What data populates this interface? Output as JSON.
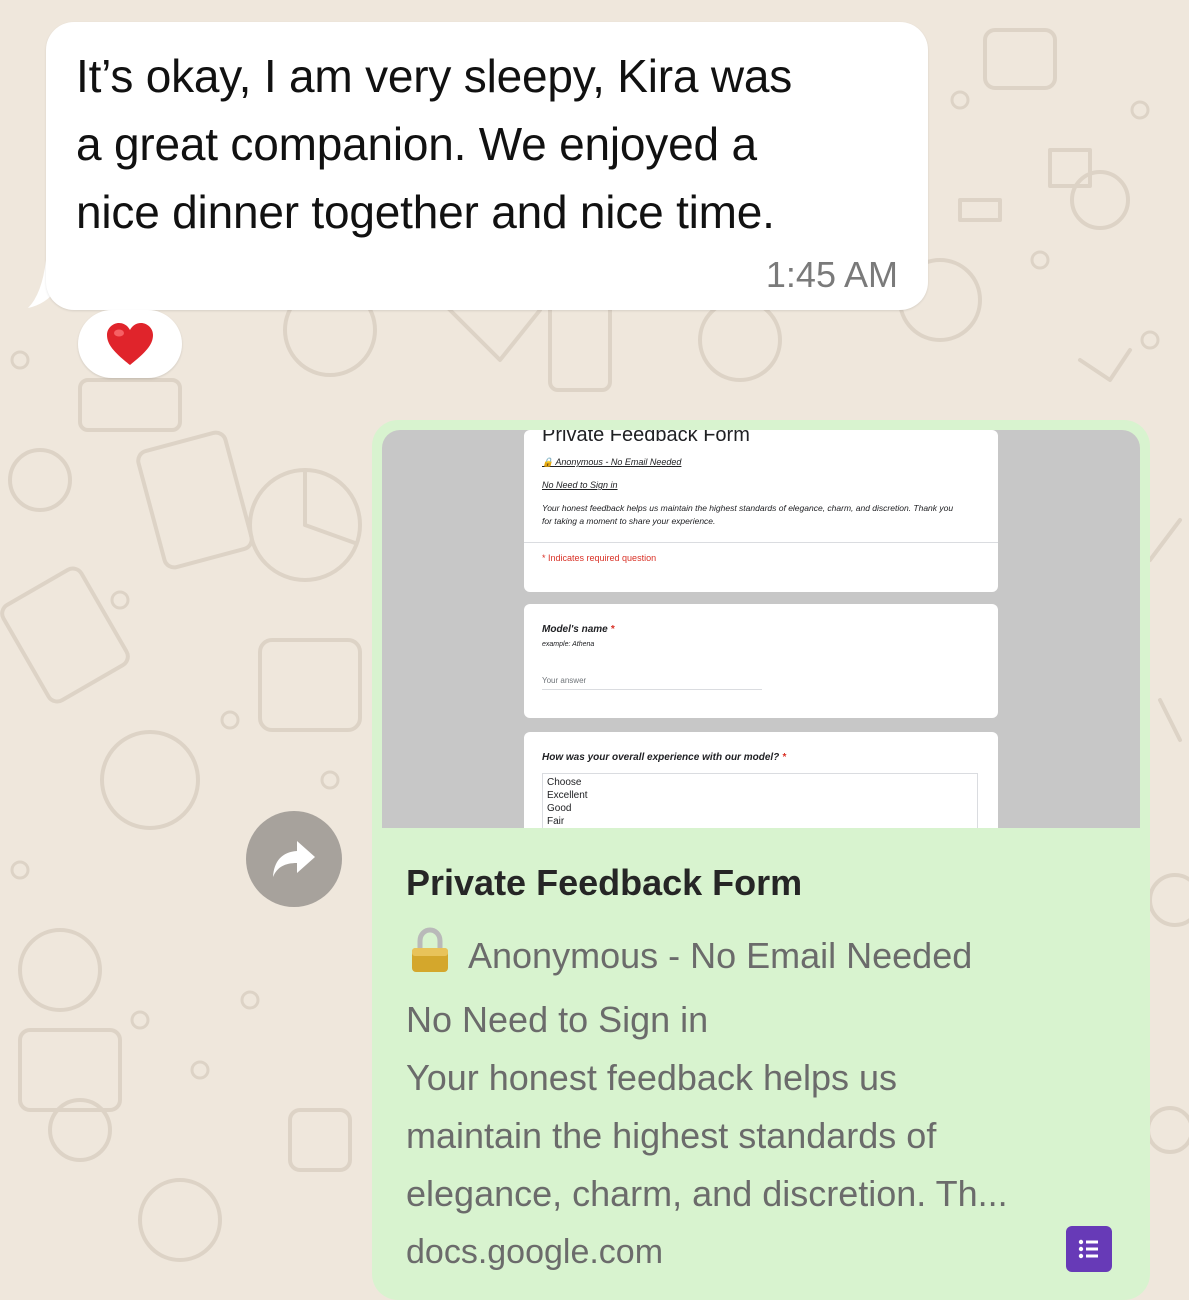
{
  "incoming_message": {
    "lines": [
      "It’s okay, I am very sleepy, Kira was",
      "a great companion. We enjoyed a",
      "nice dinner together and nice time."
    ],
    "time": "1:45 AM",
    "reaction": "❤️"
  },
  "link_preview": {
    "image": {
      "form_title": "Private Feedback Form",
      "line_anonymous": "🔒 Anonymous - No Email Needed",
      "line_sign_in": "No Need to Sign in",
      "description": "Your honest feedback helps us maintain the highest standards of elegance, charm, and discretion. Thank you for taking a moment to share your experience.",
      "required_note": "* Indicates required question",
      "q1_label": "Model's name",
      "q1_example": "example: Athena",
      "q1_placeholder": "Your answer",
      "q2_label": "How was your overall experience with our model?",
      "q2_options": [
        "Choose",
        "Excellent",
        "Good",
        "Fair"
      ]
    },
    "title": "Private Feedback Form",
    "desc_lines": [
      "Anonymous - No Email Needed",
      "No Need to Sign in",
      "Your honest feedback helps us",
      "maintain the highest standards of",
      "elegance, charm, and discretion. Th..."
    ],
    "domain": "docs.google.com",
    "icons": {
      "lock": "lock-icon",
      "site": "google-forms-icon"
    }
  },
  "colors": {
    "chat_background": "#efe7dc",
    "incoming_bubble": "#ffffff",
    "outgoing_bubble": "#d8f3cf",
    "forms_purple": "#673ab7"
  }
}
